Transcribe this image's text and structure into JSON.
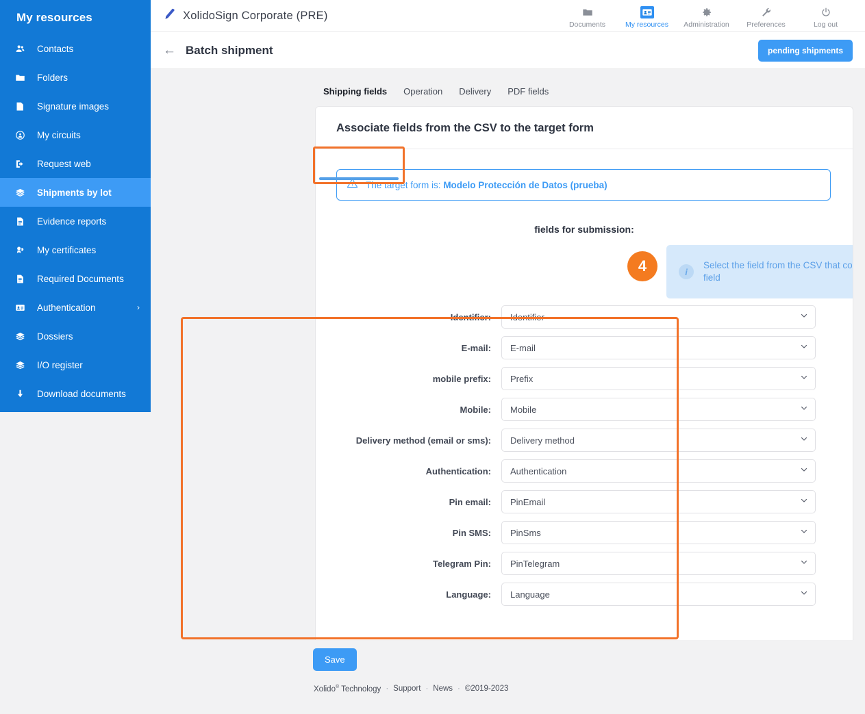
{
  "sidebar": {
    "title": "My resources",
    "items": [
      {
        "label": "Contacts",
        "icon": "contacts-icon",
        "active": false,
        "caret": ""
      },
      {
        "label": "Folders",
        "icon": "folder-icon",
        "active": false,
        "caret": ""
      },
      {
        "label": "Signature images",
        "icon": "signature-image-icon",
        "active": false,
        "caret": ""
      },
      {
        "label": "My circuits",
        "icon": "circuit-icon",
        "active": false,
        "caret": ""
      },
      {
        "label": "Request web",
        "icon": "request-web-icon",
        "active": false,
        "caret": ""
      },
      {
        "label": "Shipments by lot",
        "icon": "layers-icon",
        "active": true,
        "caret": ""
      },
      {
        "label": "Evidence reports",
        "icon": "document-icon",
        "active": false,
        "caret": ""
      },
      {
        "label": "My certificates",
        "icon": "certificate-icon",
        "active": false,
        "caret": ""
      },
      {
        "label": "Required Documents",
        "icon": "required-document-icon",
        "active": false,
        "caret": ""
      },
      {
        "label": "Authentication",
        "icon": "id-card-icon",
        "active": false,
        "caret": "›"
      },
      {
        "label": "Dossiers",
        "icon": "layers-icon",
        "active": false,
        "caret": ""
      },
      {
        "label": "I/O register",
        "icon": "layers-icon",
        "active": false,
        "caret": ""
      },
      {
        "label": "Download documents",
        "icon": "download-icon",
        "active": false,
        "caret": ""
      }
    ]
  },
  "topbar": {
    "logo_icon": "pen-icon",
    "brand": "XolidoSign Corporate (PRE)",
    "nav": [
      {
        "label": "Documents",
        "icon": "folder-icon",
        "active": false
      },
      {
        "label": "My resources",
        "icon": "id-card-icon",
        "active": true
      },
      {
        "label": "Administration",
        "icon": "gear-icon",
        "active": false
      },
      {
        "label": "Preferences",
        "icon": "wrench-icon",
        "active": false
      },
      {
        "label": "Log out",
        "icon": "power-icon",
        "active": false
      }
    ]
  },
  "subbar": {
    "back_icon": "back-arrow-icon",
    "title": "Batch shipment",
    "pending_button": "pending shipments"
  },
  "tabs": [
    {
      "label": "Shipping fields",
      "active": true
    },
    {
      "label": "Operation",
      "active": false
    },
    {
      "label": "Delivery",
      "active": false
    },
    {
      "label": "PDF fields",
      "active": false
    }
  ],
  "card": {
    "title": "Associate fields from the CSV to the target form",
    "alert": {
      "icon": "warning-triangle-icon",
      "prefix": "The target form is:",
      "form_name": "Modelo Protección de Datos (prueba)"
    },
    "fields_heading": "fields for submission:",
    "step_number": "4",
    "info": {
      "icon": "info-icon",
      "text": "Select the field from the CSV that contains the corresponding field"
    },
    "fields": [
      {
        "label": "Identifier:",
        "value": "Identifier"
      },
      {
        "label": "E-mail:",
        "value": "E-mail"
      },
      {
        "label": "mobile prefix:",
        "value": "Prefix"
      },
      {
        "label": "Mobile:",
        "value": "Mobile"
      },
      {
        "label": "Delivery method (email or sms):",
        "value": "Delivery method"
      },
      {
        "label": "Authentication:",
        "value": "Authentication"
      },
      {
        "label": "Pin email:",
        "value": "PinEmail"
      },
      {
        "label": "Pin SMS:",
        "value": "PinSms"
      },
      {
        "label": "Telegram Pin:",
        "value": "PinTelegram"
      },
      {
        "label": "Language:",
        "value": "Language"
      }
    ]
  },
  "save_button": "Save",
  "footer": {
    "company": "Xolido",
    "company_sup": "®",
    "company_tail": " Technology",
    "links": [
      "Support",
      "News"
    ],
    "copyright": "©2019-2023",
    "separator": "·"
  },
  "colors": {
    "sidebar_blue": "#1279d6",
    "sidebar_active_blue": "#3d9bf5",
    "accent_blue": "#3d9bf5",
    "highlight_orange": "#f2722a",
    "step_orange": "#f47b20",
    "info_bg": "#d6e9fb",
    "info_text": "#5ca0e8"
  }
}
